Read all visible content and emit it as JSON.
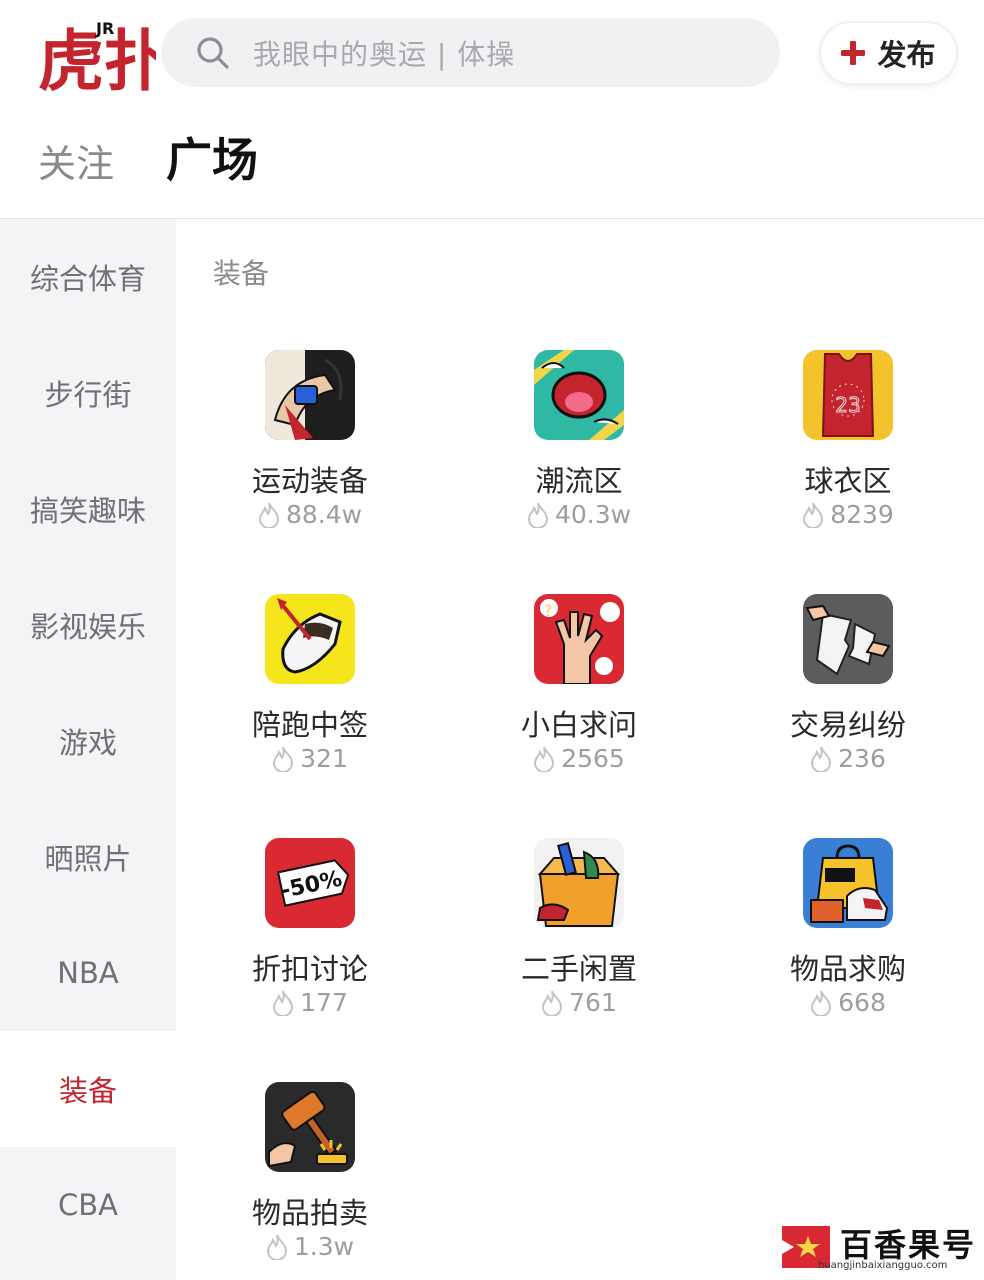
{
  "header": {
    "logo_text": "虎扑",
    "logo_badge": "JR",
    "search_placeholder": "我眼中的奥运 | 体操",
    "publish_label": "发布"
  },
  "tabs": [
    {
      "label": "关注",
      "active": false
    },
    {
      "label": "广场",
      "active": true
    }
  ],
  "sidebar": {
    "items": [
      {
        "label": "综合体育",
        "active": false
      },
      {
        "label": "步行街",
        "active": false
      },
      {
        "label": "搞笑趣味",
        "active": false
      },
      {
        "label": "影视娱乐",
        "active": false
      },
      {
        "label": "游戏",
        "active": false
      },
      {
        "label": "晒照片",
        "active": false
      },
      {
        "label": "NBA",
        "active": false
      },
      {
        "label": "装备",
        "active": true
      },
      {
        "label": "CBA",
        "active": false
      }
    ]
  },
  "content": {
    "section_title": "装备",
    "boards": [
      {
        "name": "运动装备",
        "heat": "88.4w",
        "icon": "sports-gear-icon"
      },
      {
        "name": "潮流区",
        "heat": "40.3w",
        "icon": "streetwear-icon"
      },
      {
        "name": "球衣区",
        "heat": "8239",
        "icon": "jersey-icon"
      },
      {
        "name": "陪跑中签",
        "heat": "321",
        "icon": "sneaker-draw-icon"
      },
      {
        "name": "小白求问",
        "heat": "2565",
        "icon": "question-hand-icon"
      },
      {
        "name": "交易纠纷",
        "heat": "236",
        "icon": "torn-receipt-icon"
      },
      {
        "name": "折扣讨论",
        "heat": "177",
        "icon": "sale-tag-icon"
      },
      {
        "name": "二手闲置",
        "heat": "761",
        "icon": "secondhand-box-icon"
      },
      {
        "name": "物品求购",
        "heat": "668",
        "icon": "wanted-bag-icon"
      },
      {
        "name": "物品拍卖",
        "heat": "1.3w",
        "icon": "auction-hammer-icon"
      }
    ]
  },
  "watermark": {
    "name": "百香果号",
    "url": "huangjinbaixiangguo.com"
  },
  "colors": {
    "brand_red": "#c4242d",
    "sidebar_bg": "#f4f4f6",
    "search_bg": "#f1f1f3"
  }
}
